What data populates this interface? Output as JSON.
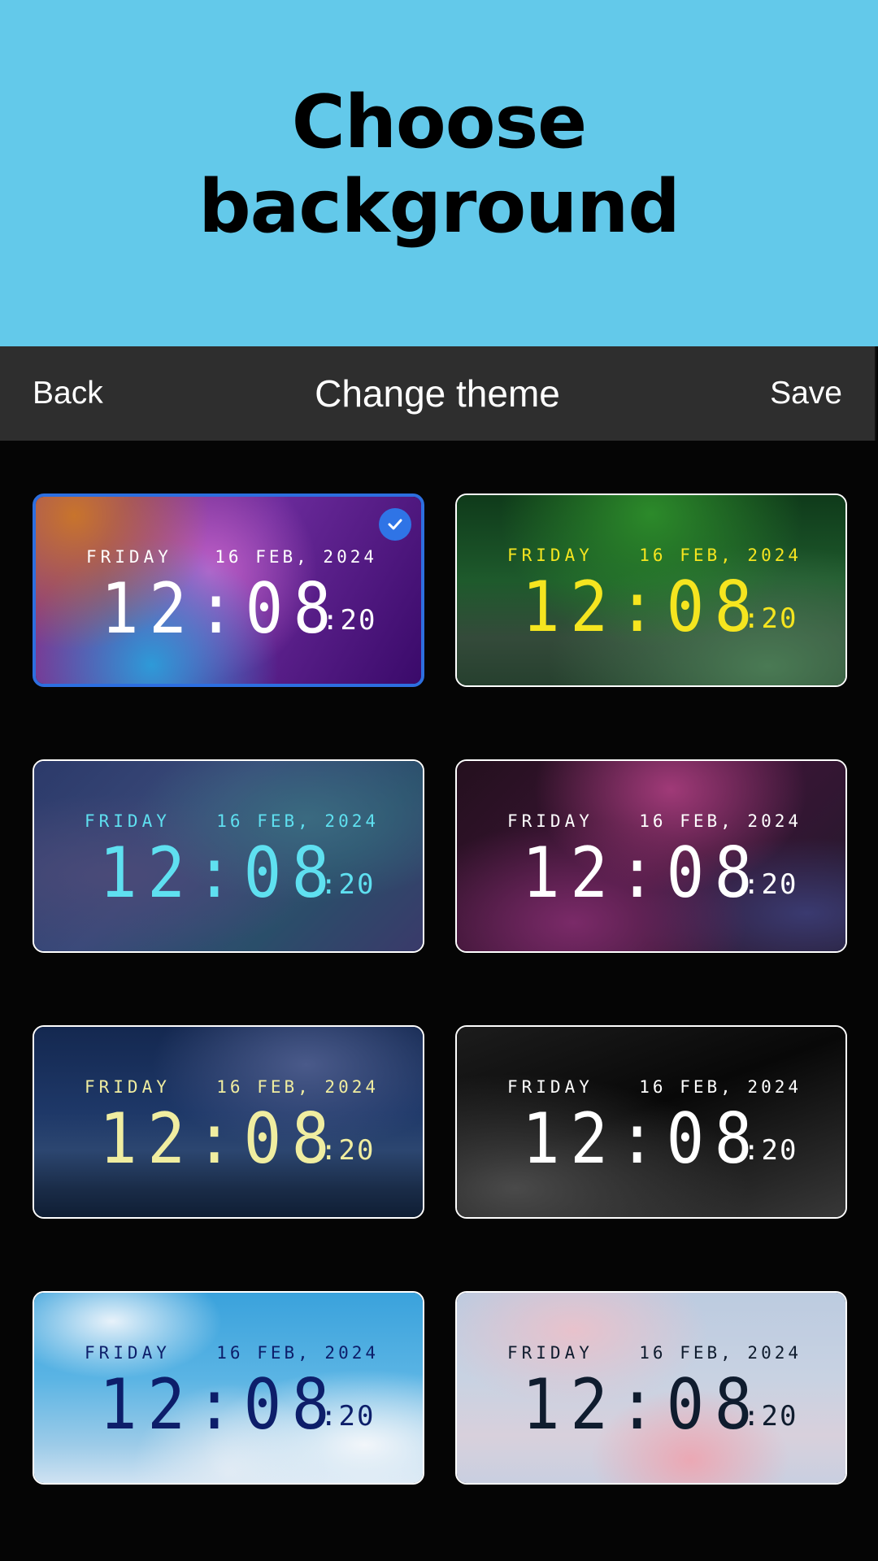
{
  "header": {
    "title": "Choose background"
  },
  "toolbar": {
    "back_label": "Back",
    "title": "Change theme",
    "save_label": "Save"
  },
  "themes": [
    {
      "day": "FRIDAY",
      "date": "16 FEB, 2024",
      "time": "12:08",
      "seconds": ":20",
      "text_color": "#ffffff",
      "selected": true
    },
    {
      "day": "FRIDAY",
      "date": "16 FEB, 2024",
      "time": "12:08",
      "seconds": ":20",
      "text_color": "#f5e51f",
      "selected": false
    },
    {
      "day": "FRIDAY",
      "date": "16 FEB, 2024",
      "time": "12:08",
      "seconds": ":20",
      "text_color": "#5fe0f0",
      "selected": false
    },
    {
      "day": "FRIDAY",
      "date": "16 FEB, 2024",
      "time": "12:08",
      "seconds": ":20",
      "text_color": "#ffffff",
      "selected": false
    },
    {
      "day": "FRIDAY",
      "date": "16 FEB, 2024",
      "time": "12:08",
      "seconds": ":20",
      "text_color": "#f0eda0",
      "selected": false
    },
    {
      "day": "FRIDAY",
      "date": "16 FEB, 2024",
      "time": "12:08",
      "seconds": ":20",
      "text_color": "#ffffff",
      "selected": false
    },
    {
      "day": "FRIDAY",
      "date": "16 FEB, 2024",
      "time": "12:08",
      "seconds": ":20",
      "text_color": "#0d1e6a",
      "selected": false
    },
    {
      "day": "FRIDAY",
      "date": "16 FEB, 2024",
      "time": "12:08",
      "seconds": ":20",
      "text_color": "#0f1c2e",
      "selected": false
    }
  ],
  "colors": {
    "accent": "#2f74e6",
    "hero_bg": "#63c9ea",
    "bar_bg": "#2e2e2e"
  }
}
